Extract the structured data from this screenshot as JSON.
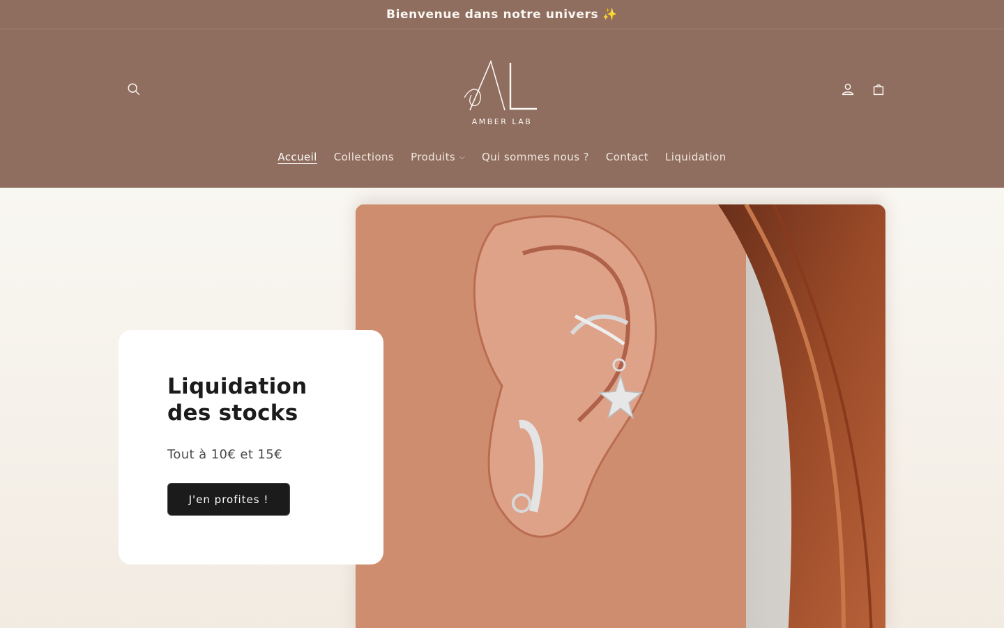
{
  "announcement": {
    "text": "Bienvenue dans notre univers",
    "emoji": "✨"
  },
  "header": {
    "logo_text": "AMBER LAB",
    "icons": {
      "search": "search-icon",
      "account": "account-icon",
      "cart": "cart-icon"
    }
  },
  "nav": {
    "items": [
      {
        "label": "Accueil",
        "active": true
      },
      {
        "label": "Collections"
      },
      {
        "label": "Produits",
        "has_dropdown": true
      },
      {
        "label": "Qui sommes nous ?"
      },
      {
        "label": "Contact"
      },
      {
        "label": "Liquidation"
      }
    ]
  },
  "hero": {
    "title": "Liquidation des stocks",
    "subtitle": "Tout à 10€ et 15€",
    "button_label": "J'en profites !"
  },
  "colors": {
    "header_bg": "#8f6e5f",
    "button_bg": "#1b1b1b",
    "page_bg": "#f5f2ec"
  }
}
